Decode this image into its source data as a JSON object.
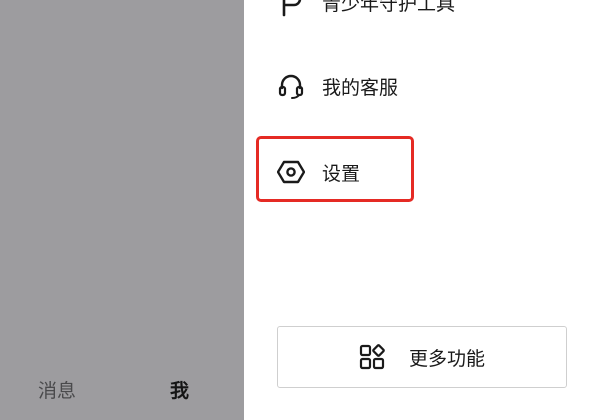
{
  "bottom_tabs": {
    "messages": "消息",
    "me": "我"
  },
  "drawer": {
    "items": [
      {
        "label": "青少年守护工具",
        "icon": "shield-key-icon"
      },
      {
        "label": "我的客服",
        "icon": "headset-icon"
      },
      {
        "label": "设置",
        "icon": "hexagon-gear-icon"
      }
    ],
    "more_button": {
      "label": "更多功能",
      "icon": "grid-apps-icon"
    }
  },
  "colors": {
    "backdrop": "#9d9c9f",
    "highlight": "#e52a24",
    "text": "#1a1a1a"
  }
}
